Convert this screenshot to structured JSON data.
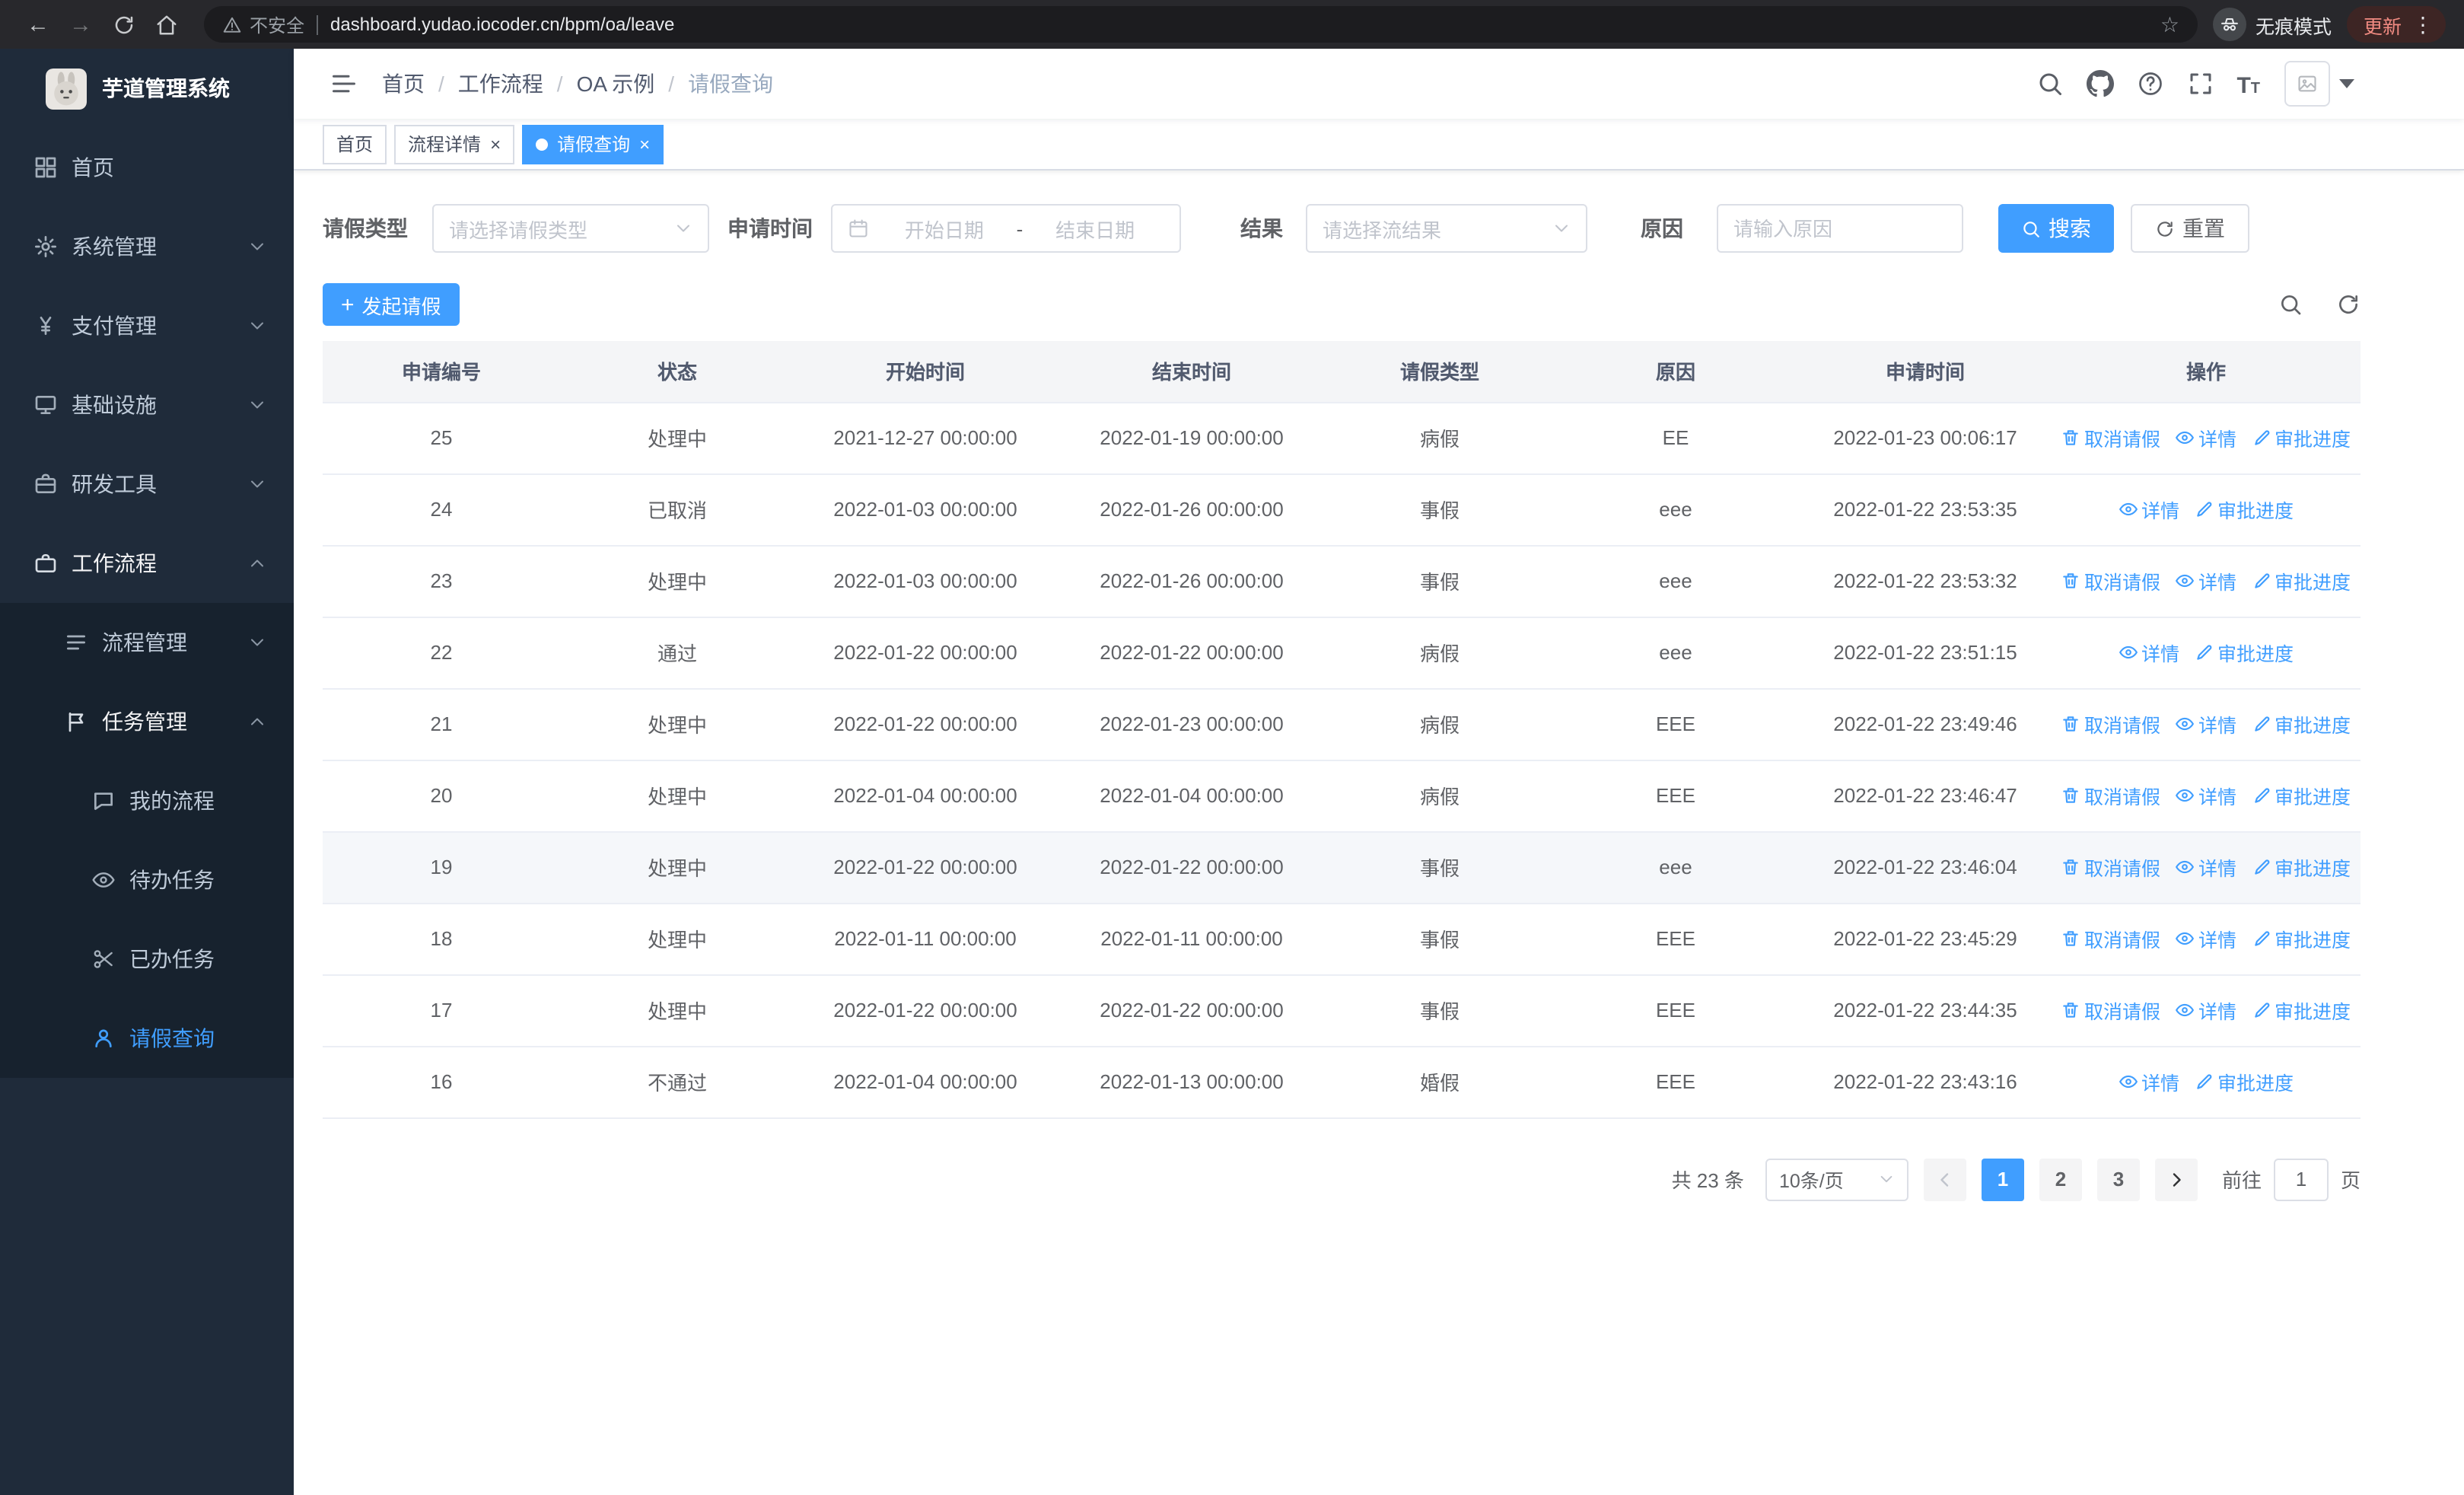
{
  "browser": {
    "url": "dashboard.yudao.iocoder.cn/bpm/oa/leave",
    "security_label": "不安全",
    "incognito_label": "无痕模式",
    "update_label": "更新"
  },
  "sidebar": {
    "app_title": "芋道管理系统",
    "items": [
      {
        "key": "home",
        "label": "首页",
        "icon": "dashboard-icon",
        "level": 1
      },
      {
        "key": "system-mgmt",
        "label": "系统管理",
        "icon": "gear-icon",
        "level": 1,
        "arrow": "down"
      },
      {
        "key": "payment-mgmt",
        "label": "支付管理",
        "icon": "payment-icon",
        "level": 1,
        "arrow": "down"
      },
      {
        "key": "infrastructure",
        "label": "基础设施",
        "icon": "infra-icon",
        "level": 1,
        "arrow": "down"
      },
      {
        "key": "dev-tools",
        "label": "研发工具",
        "icon": "devtools-icon",
        "level": 1,
        "arrow": "down"
      },
      {
        "key": "workflow",
        "label": "工作流程",
        "icon": "workflow-icon",
        "level": 1,
        "arrow": "up",
        "expanded": true
      },
      {
        "key": "process-mgmt",
        "label": "流程管理",
        "icon": "process-icon",
        "level": 2,
        "arrow": "down"
      },
      {
        "key": "task-mgmt",
        "label": "任务管理",
        "icon": "task-icon",
        "level": 2,
        "arrow": "up",
        "expanded": true
      },
      {
        "key": "my-process",
        "label": "我的流程",
        "icon": "myflow-icon",
        "level": 3
      },
      {
        "key": "todo-task",
        "label": "待办任务",
        "icon": "todo-icon",
        "level": 3
      },
      {
        "key": "done-task",
        "label": "已办任务",
        "icon": "done-icon",
        "level": 3
      },
      {
        "key": "leave-query",
        "label": "请假查询",
        "icon": "leave-icon",
        "level": 3,
        "active": true
      }
    ]
  },
  "header": {
    "breadcrumb": [
      "首页",
      "工作流程",
      "OA 示例",
      "请假查询"
    ]
  },
  "tabs": [
    {
      "key": "home",
      "label": "首页",
      "closable": false,
      "active": false
    },
    {
      "key": "process-detail",
      "label": "流程详情",
      "closable": true,
      "active": false
    },
    {
      "key": "leave-query",
      "label": "请假查询",
      "closable": true,
      "active": true
    }
  ],
  "filters": {
    "leave_type_label": "请假类型",
    "leave_type_placeholder": "请选择请假类型",
    "apply_time_label": "申请时间",
    "start_placeholder": "开始日期",
    "range_separator": "-",
    "end_placeholder": "结束日期",
    "result_label": "结果",
    "result_placeholder": "请选择流结果",
    "reason_label": "原因",
    "reason_placeholder": "请输入原因",
    "search_label": "搜索",
    "reset_label": "重置"
  },
  "toolbar": {
    "create_label": "发起请假"
  },
  "table": {
    "columns": [
      "申请编号",
      "状态",
      "开始时间",
      "结束时间",
      "请假类型",
      "原因",
      "申请时间",
      "操作"
    ],
    "action_labels": {
      "cancel": "取消请假",
      "detail": "详情",
      "progress": "审批进度"
    },
    "rows": [
      {
        "id": "25",
        "status": "处理中",
        "start": "2021-12-27 00:00:00",
        "end": "2022-01-19 00:00:00",
        "type": "病假",
        "reason": "EE",
        "apply_time": "2022-01-23 00:06:17",
        "actions": [
          "cancel",
          "detail",
          "progress"
        ]
      },
      {
        "id": "24",
        "status": "已取消",
        "start": "2022-01-03 00:00:00",
        "end": "2022-01-26 00:00:00",
        "type": "事假",
        "reason": "eee",
        "apply_time": "2022-01-22 23:53:35",
        "actions": [
          "detail",
          "progress"
        ]
      },
      {
        "id": "23",
        "status": "处理中",
        "start": "2022-01-03 00:00:00",
        "end": "2022-01-26 00:00:00",
        "type": "事假",
        "reason": "eee",
        "apply_time": "2022-01-22 23:53:32",
        "actions": [
          "cancel",
          "detail",
          "progress"
        ]
      },
      {
        "id": "22",
        "status": "通过",
        "start": "2022-01-22 00:00:00",
        "end": "2022-01-22 00:00:00",
        "type": "病假",
        "reason": "eee",
        "apply_time": "2022-01-22 23:51:15",
        "actions": [
          "detail",
          "progress"
        ]
      },
      {
        "id": "21",
        "status": "处理中",
        "start": "2022-01-22 00:00:00",
        "end": "2022-01-23 00:00:00",
        "type": "病假",
        "reason": "EEE",
        "apply_time": "2022-01-22 23:49:46",
        "actions": [
          "cancel",
          "detail",
          "progress"
        ]
      },
      {
        "id": "20",
        "status": "处理中",
        "start": "2022-01-04 00:00:00",
        "end": "2022-01-04 00:00:00",
        "type": "病假",
        "reason": "EEE",
        "apply_time": "2022-01-22 23:46:47",
        "actions": [
          "cancel",
          "detail",
          "progress"
        ]
      },
      {
        "id": "19",
        "status": "处理中",
        "start": "2022-01-22 00:00:00",
        "end": "2022-01-22 00:00:00",
        "type": "事假",
        "reason": "eee",
        "apply_time": "2022-01-22 23:46:04",
        "actions": [
          "cancel",
          "detail",
          "progress"
        ],
        "hover": true
      },
      {
        "id": "18",
        "status": "处理中",
        "start": "2022-01-11 00:00:00",
        "end": "2022-01-11 00:00:00",
        "type": "事假",
        "reason": "EEE",
        "apply_time": "2022-01-22 23:45:29",
        "actions": [
          "cancel",
          "detail",
          "progress"
        ]
      },
      {
        "id": "17",
        "status": "处理中",
        "start": "2022-01-22 00:00:00",
        "end": "2022-01-22 00:00:00",
        "type": "事假",
        "reason": "EEE",
        "apply_time": "2022-01-22 23:44:35",
        "actions": [
          "cancel",
          "detail",
          "progress"
        ]
      },
      {
        "id": "16",
        "status": "不通过",
        "start": "2022-01-04 00:00:00",
        "end": "2022-01-13 00:00:00",
        "type": "婚假",
        "reason": "EEE",
        "apply_time": "2022-01-22 23:43:16",
        "actions": [
          "detail",
          "progress"
        ]
      }
    ]
  },
  "pagination": {
    "total_text": "共 23 条",
    "page_size_value": "10条/页",
    "pages": [
      "1",
      "2",
      "3"
    ],
    "active_page": "1",
    "goto_label": "前往",
    "goto_value": "1",
    "goto_suffix": "页"
  },
  "colors": {
    "accent": "#409eff",
    "sidebar_bg": "#1f2b3a",
    "submenu_bg": "#17222e"
  }
}
